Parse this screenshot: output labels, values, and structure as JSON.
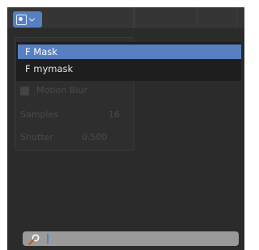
{
  "header": {
    "type_menu_icon": "mask-icon",
    "type_menu_chevron": "chevron-down-icon"
  },
  "dropdown": {
    "items": [
      {
        "label": "F Mask",
        "selected": true
      },
      {
        "label": "F mymask",
        "selected": false
      }
    ]
  },
  "background_panel": {
    "motion_blur_label": "Motion Blur",
    "samples_label": "Samples",
    "samples_value": "16",
    "shutter_label": "Shutter",
    "shutter_value": "0.500"
  },
  "search": {
    "value": "",
    "icon": "search-icon"
  },
  "colors": {
    "accent": "#5680c2",
    "background": "#2b2b2b",
    "dropdown_bg": "#1e1e1e",
    "search_bg": "#9a9a9a"
  }
}
